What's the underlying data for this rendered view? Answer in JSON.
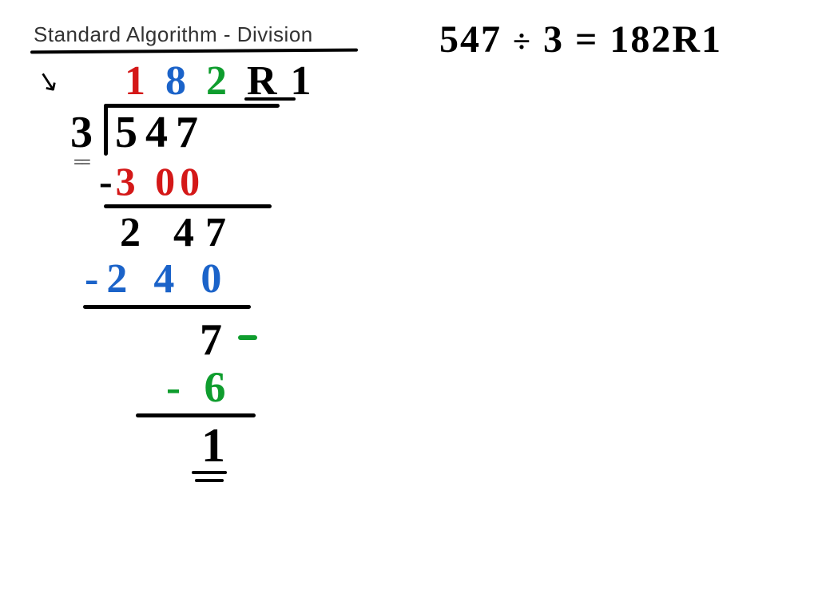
{
  "title": "Standard Algorithm - Division",
  "equation": {
    "dividend": "547",
    "op": "÷",
    "divisor": "3",
    "eq": "=",
    "result": "182R1"
  },
  "work": {
    "arrow": "↘",
    "quotient": {
      "d1": "1",
      "d2": "8",
      "d3": "2",
      "remainder": " R 1"
    },
    "divisor": "3",
    "dividend": "547",
    "step1": {
      "minus": "-",
      "value": "3 00"
    },
    "step1_result": "2 47",
    "step2": "-2 4 0",
    "step2_result": "7",
    "step3": "- 6",
    "final": "1"
  }
}
